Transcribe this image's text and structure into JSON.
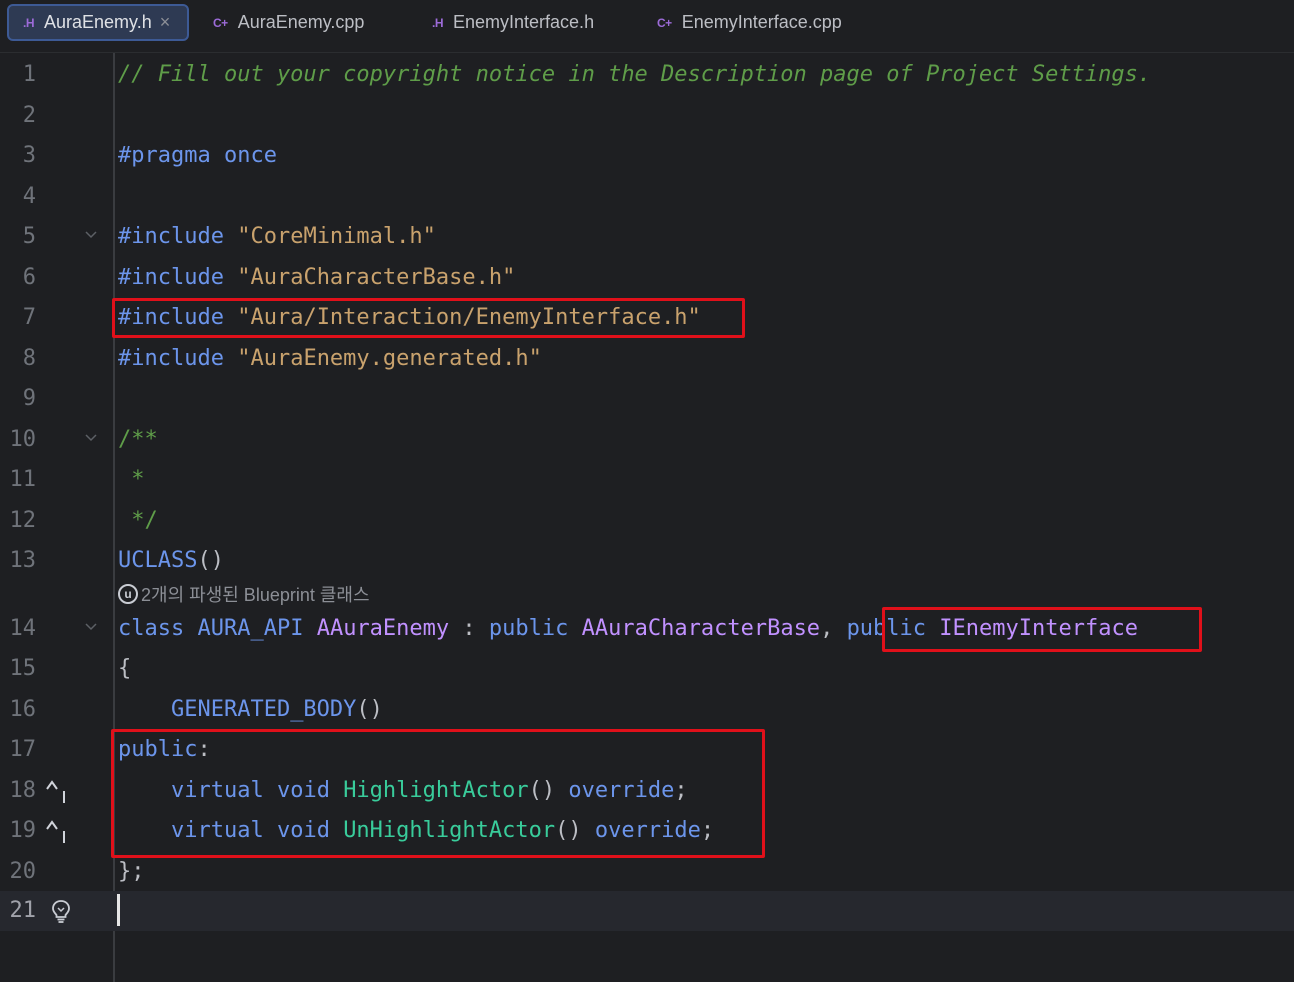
{
  "tabs": [
    {
      "icon": ".H",
      "label": "AuraEnemy.h",
      "active": true,
      "close": "×"
    },
    {
      "icon": "C+",
      "label": "AuraEnemy.cpp"
    },
    {
      "icon": ".H",
      "label": "EnemyInterface.h"
    },
    {
      "icon": "C+",
      "label": "EnemyInterface.cpp"
    }
  ],
  "editor": {
    "line_numbers": [
      "1",
      "2",
      "3",
      "4",
      "5",
      "6",
      "7",
      "8",
      "9",
      "10",
      "11",
      "12",
      "13",
      "14",
      "15",
      "16",
      "17",
      "18",
      "19",
      "20",
      "21"
    ],
    "inlay_hint": "2개의 파생된 Blueprint 클래스",
    "lines": {
      "l1": "// Fill out your copyright notice in the Description page of Project Settings.",
      "l3_kw": "#pragma",
      "l3_rest": " once",
      "inc": "#include",
      "l5_str": "\"CoreMinimal.h\"",
      "l6_str": "\"AuraCharacterBase.h\"",
      "l7_str": "\"Aura/Interaction/EnemyInterface.h\"",
      "l8_str": "\"AuraEnemy.generated.h\"",
      "l10": "/**",
      "l11": " *",
      "l12": " */",
      "l13_macro": "UCLASS",
      "l13_rest": "()",
      "l14_class": "class",
      "l14_api": "AURA_API",
      "l14_name": "AAuraEnemy",
      "l14_colon": " : ",
      "l14_public1": "public",
      "l14_base": "AAuraCharacterBase",
      "l14_comma": ", ",
      "l14_public2": "public",
      "l14_iface": "IEnemyInterface",
      "l15": "{",
      "l16_macro": "GENERATED_BODY",
      "l16_rest": "()",
      "l17_kw": "public",
      "l17_rest": ":",
      "virtual": "virtual",
      "void": "void",
      "l18_fn": "HighlightActor",
      "l19_fn": "UnHighlightActor",
      "parens": "()",
      "override": "override",
      "semi": ";",
      "l20": "};"
    }
  },
  "icons": {
    "fold": "chevron-down-icon",
    "implements": "implements-up-arrow-icon",
    "bulb": "lightbulb-icon"
  },
  "colors": {
    "background": "#1e1f22",
    "comment": "#5f9d49",
    "keyword": "#6c95eb",
    "string": "#c9a26d",
    "type": "#c191ff",
    "function": "#39cc9b",
    "highlight_box": "#e0101a"
  }
}
